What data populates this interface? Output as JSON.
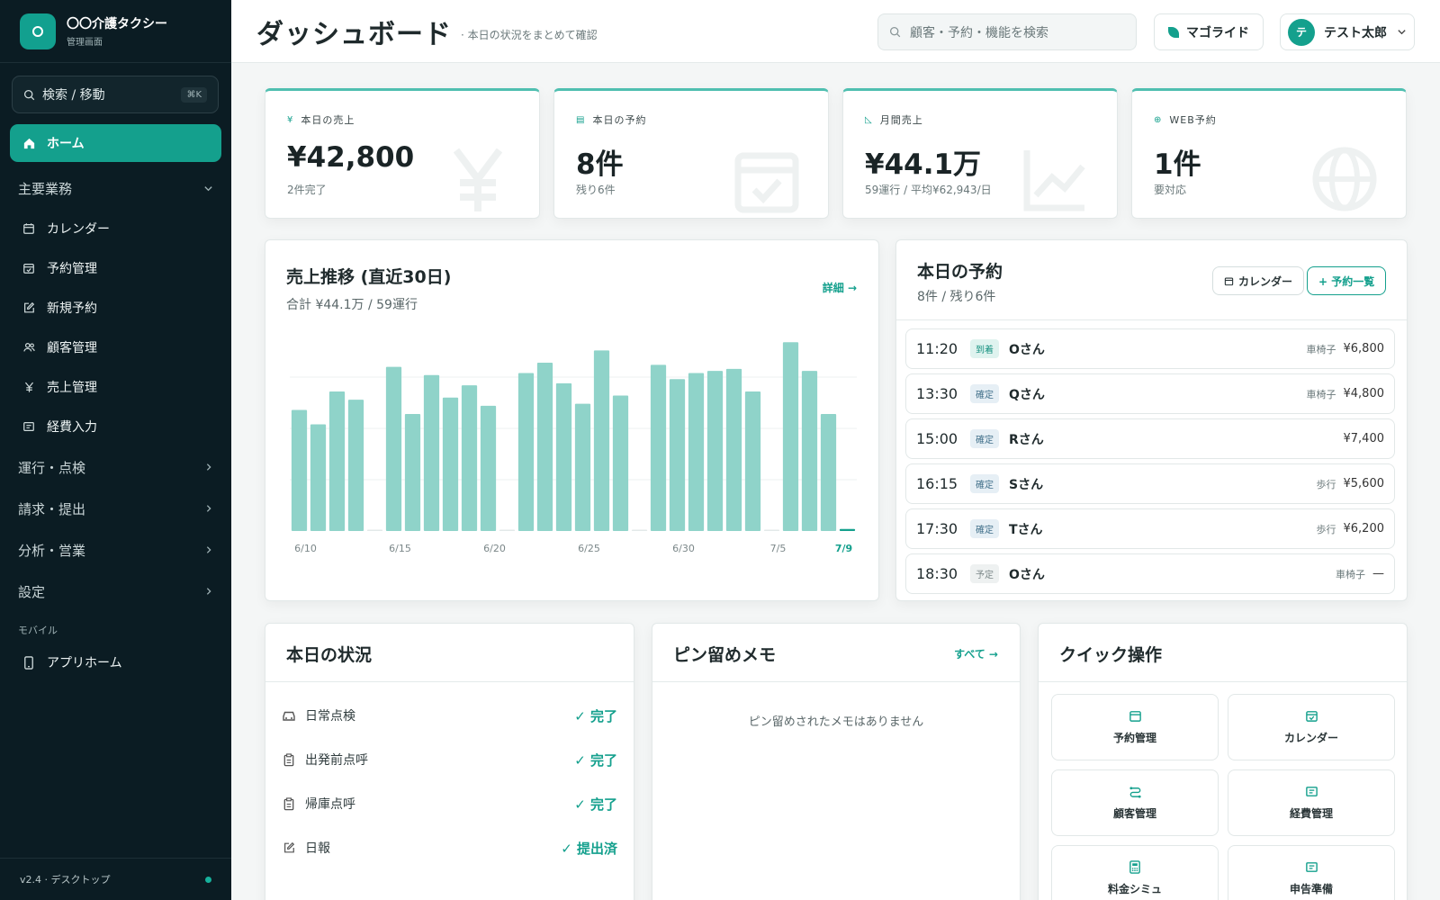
{
  "sidebar": {
    "brand_name": "〇〇介護タクシー",
    "brand_sub": "管理画面",
    "search_label": "検索 / 移動",
    "search_shortcut": "⌘K",
    "home": "ホーム",
    "group_main": "主要業務",
    "items": [
      {
        "label": "カレンダー",
        "icon": "calendar-icon"
      },
      {
        "label": "予約管理",
        "icon": "calendar-check-icon"
      },
      {
        "label": "新規予約",
        "icon": "edit-icon"
      },
      {
        "label": "顧客管理",
        "icon": "users-icon"
      },
      {
        "label": "売上管理",
        "icon": "yen-icon"
      },
      {
        "label": "経費入力",
        "icon": "receipt-icon"
      }
    ],
    "groups": [
      "運行・点検",
      "請求・提出",
      "分析・営業",
      "設定"
    ],
    "mobile_label": "モバイル",
    "mobile_item": "アプリホーム",
    "footer": "v2.4 · デスクトップ"
  },
  "header": {
    "title": "ダッシュボード",
    "subtitle": "· 本日の状況をまとめて確認",
    "search_placeholder": "顧客・予約・機能を検索",
    "theme": "マゴライド",
    "user_initial": "テ",
    "user_name": "テスト太郎"
  },
  "stats": [
    {
      "label": "本日の売上",
      "value": "¥42,800",
      "sub": "2件完了",
      "icon": "yen-icon"
    },
    {
      "label": "本日の予約",
      "value": "8件",
      "sub": "残り6件",
      "icon": "calendar-icon"
    },
    {
      "label": "月間売上",
      "value": "¥44.1万",
      "sub": "59運行 / 平均¥62,943/日",
      "icon": "chart-icon"
    },
    {
      "label": "WEB予約",
      "value": "1件",
      "sub": "要対応",
      "icon": "globe-icon"
    }
  ],
  "sales_chart": {
    "title": "売上推移 (直近30日)",
    "subtitle": "合計 ¥44.1万 / 59運行",
    "detail_link": "詳細 →"
  },
  "chart_data": {
    "type": "bar",
    "ylim": [
      0,
      100
    ],
    "grid": true,
    "highlight_last": true,
    "ticks": [
      "6/10",
      "6/15",
      "6/20",
      "6/25",
      "6/30",
      "7/5",
      "7/9"
    ],
    "categories": [
      "6/10",
      "6/11",
      "6/12",
      "6/13",
      "6/14",
      "6/15",
      "6/16",
      "6/17",
      "6/18",
      "6/19",
      "6/20",
      "6/21",
      "6/22",
      "6/23",
      "6/24",
      "6/25",
      "6/26",
      "6/27",
      "6/28",
      "6/29",
      "6/30",
      "7/1",
      "7/2",
      "7/3",
      "7/4",
      "7/5",
      "7/6",
      "7/7",
      "7/8",
      "7/9"
    ],
    "values": [
      59,
      52,
      68,
      64,
      0,
      80,
      57,
      76,
      65,
      71,
      61,
      0,
      77,
      82,
      72,
      62,
      88,
      66,
      0,
      81,
      74,
      77,
      78,
      79,
      68,
      0,
      92,
      78,
      57,
      1
    ]
  },
  "bookings": {
    "title": "本日の予約",
    "subtitle": "8件 / 残り6件",
    "calendar_btn": "カレンダー",
    "list_btn": "+ 予約一覧",
    "rows": [
      {
        "time": "11:20",
        "status": "到着",
        "kind": "arrived",
        "name": "Oさん",
        "type": "車椅子",
        "amount": "¥6,800"
      },
      {
        "time": "13:30",
        "status": "確定",
        "kind": "conf",
        "name": "Qさん",
        "type": "車椅子",
        "amount": "¥4,800"
      },
      {
        "time": "15:00",
        "status": "確定",
        "kind": "conf",
        "name": "Rさん",
        "type": "",
        "amount": "¥7,400"
      },
      {
        "time": "16:15",
        "status": "確定",
        "kind": "conf",
        "name": "Sさん",
        "type": "歩行",
        "amount": "¥5,600"
      },
      {
        "time": "17:30",
        "status": "確定",
        "kind": "conf",
        "name": "Tさん",
        "type": "歩行",
        "amount": "¥6,200"
      },
      {
        "time": "18:30",
        "status": "予定",
        "kind": "plan",
        "name": "Oさん",
        "type": "車椅子",
        "amount": "—"
      }
    ]
  },
  "today_status": {
    "title": "本日の状況",
    "rows": [
      {
        "label": "日常点検",
        "value": "✓ 完了",
        "icon": "car-icon"
      },
      {
        "label": "出発前点呼",
        "value": "✓ 完了",
        "icon": "clipboard-icon"
      },
      {
        "label": "帰庫点呼",
        "value": "✓ 完了",
        "icon": "clipboard-icon"
      },
      {
        "label": "日報",
        "value": "✓ 提出済",
        "icon": "edit-icon"
      }
    ]
  },
  "memo": {
    "title": "ピン留めメモ",
    "link": "すべて →",
    "empty": "ピン留めされたメモはありません"
  },
  "quick": {
    "title": "クイック操作",
    "buttons": [
      {
        "label": "予約管理",
        "icon": "calendar-icon"
      },
      {
        "label": "カレンダー",
        "icon": "calendar-check-icon"
      },
      {
        "label": "顧客管理",
        "icon": "route-icon"
      },
      {
        "label": "経費管理",
        "icon": "receipt-icon"
      },
      {
        "label": "料金シミュ",
        "icon": "calculator-icon"
      },
      {
        "label": "申告準備",
        "icon": "receipt-icon"
      }
    ]
  }
}
